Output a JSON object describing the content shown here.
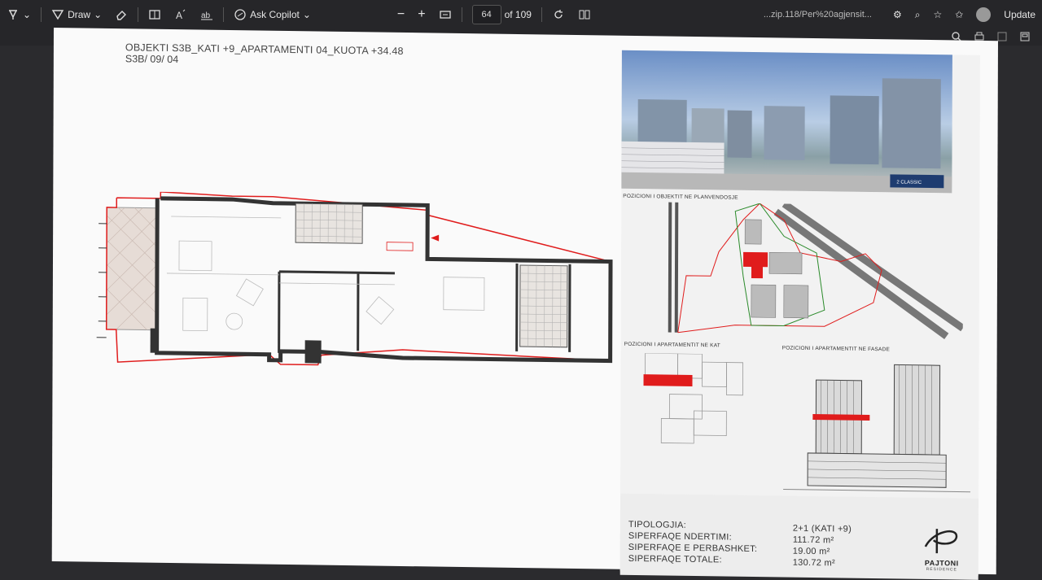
{
  "toolbar": {
    "draw_label": "Draw",
    "copilot_label": "Ask Copilot",
    "page_current": "64",
    "page_total": "of 109",
    "filename": "...zip.118/Per%20agjensit...",
    "update_label": "Update"
  },
  "document": {
    "title_line1": "OBJEKTI S3B_KATI +9_APARTAMENTI 04_KUOTA +34.48",
    "title_line2": "S3B/ 09/ 04",
    "caption_site": "POZICIONI I OBJEKTIT NE PLANVENDOSJE",
    "caption_floor": "POZICIONI I APARTAMENTIT NE KAT",
    "caption_facade": "POZICIONI I APARTAMENTIT NE FASADE",
    "photo_sign": "2 CLASSIC",
    "info": {
      "tipologjia_label": "TIPOLOGJIA:",
      "tipologjia_value": "2+1 (KATI +9)",
      "ndertimi_label": "SIPERFAQE  NDERTIMI:",
      "ndertimi_value": "111.72 m²",
      "perbashket_label": "SIPERFAQE  E  PERBASHKET:",
      "perbashket_value": "19.00 m²",
      "totale_label": "SIPERFAQE  TOTALE:",
      "totale_value": "130.72 m²"
    },
    "logo_name": "PAJTONI",
    "logo_sub": "RESIDENCE"
  }
}
